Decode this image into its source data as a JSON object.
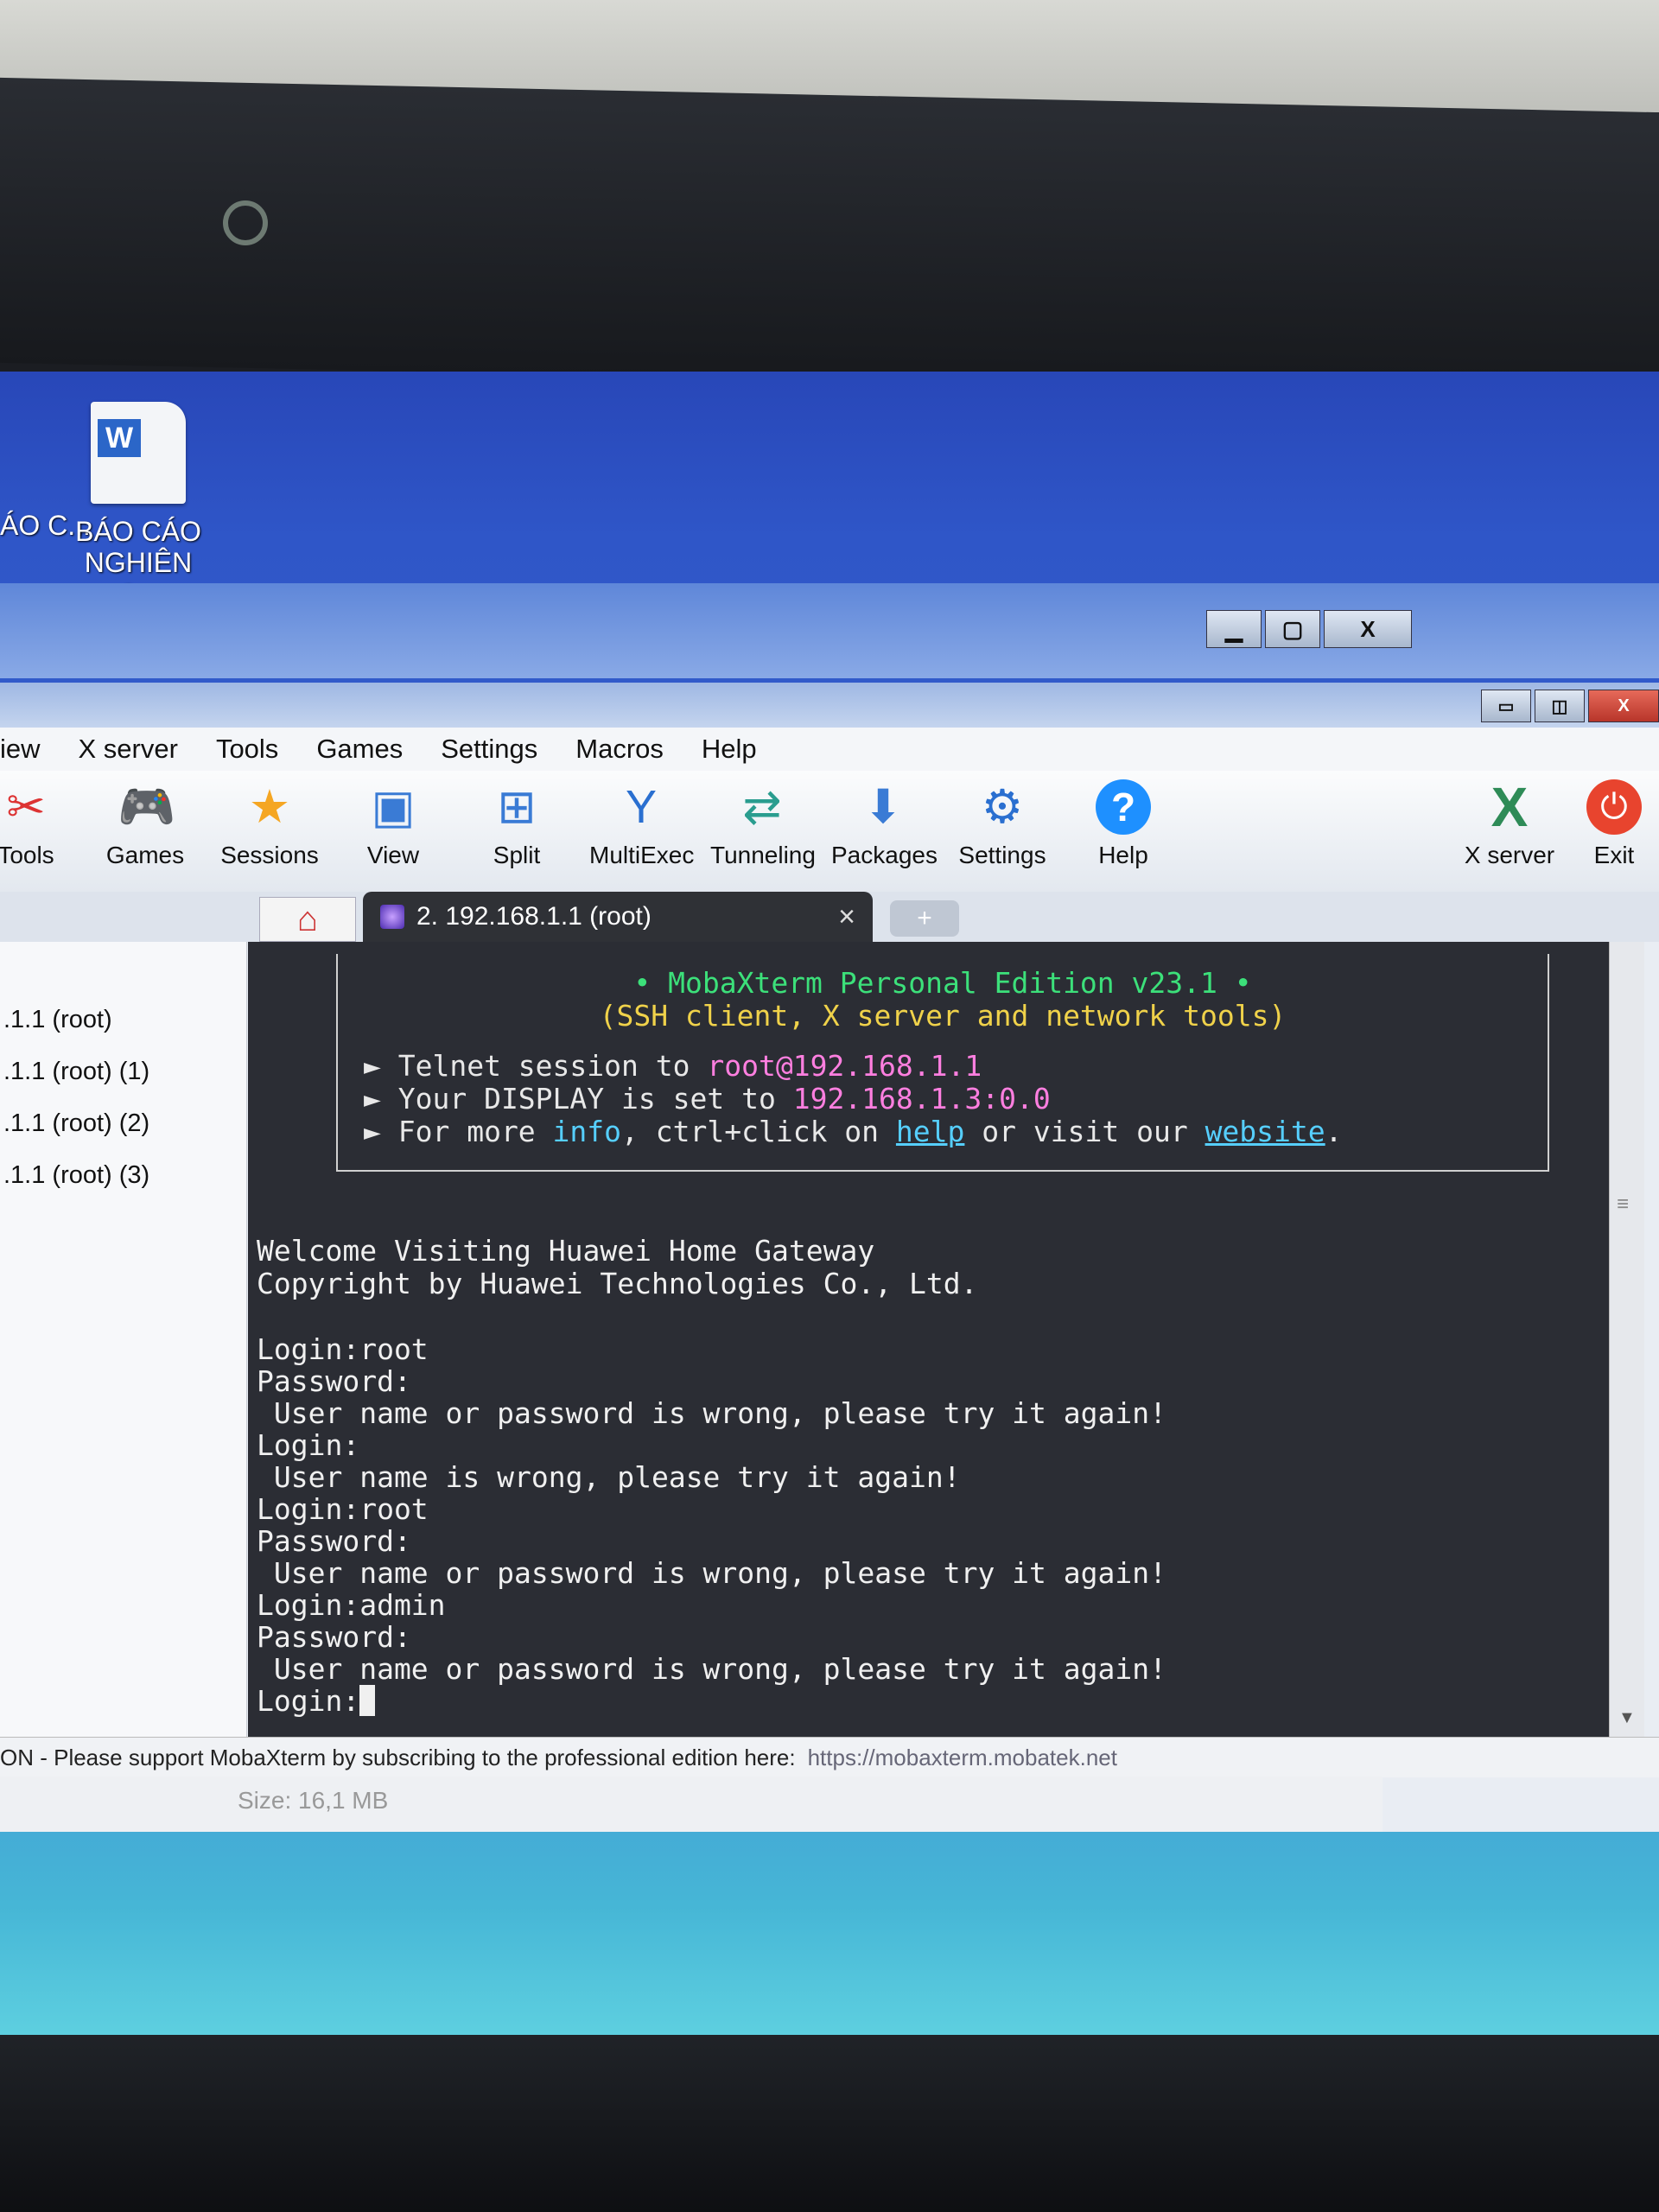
{
  "desktop": {
    "icon_label": "BÁO CÁO NGHIÊN C...",
    "left_cut_label": "ÁO C..."
  },
  "back_window": {
    "buttons": [
      "▁",
      "▢",
      "X"
    ]
  },
  "app": {
    "window_buttons": [
      "▭",
      "◫",
      "X"
    ],
    "menu": [
      "iew",
      "X server",
      "Tools",
      "Games",
      "Settings",
      "Macros",
      "Help"
    ],
    "toolbar": [
      {
        "label": "Tools",
        "icon": "tools-icon"
      },
      {
        "label": "Games",
        "icon": "gamepad-icon"
      },
      {
        "label": "Sessions",
        "icon": "star-icon"
      },
      {
        "label": "View",
        "icon": "view-icon"
      },
      {
        "label": "Split",
        "icon": "split-icon"
      },
      {
        "label": "MultiExec",
        "icon": "multiexec-icon"
      },
      {
        "label": "Tunneling",
        "icon": "tunneling-icon"
      },
      {
        "label": "Packages",
        "icon": "packages-icon"
      },
      {
        "label": "Settings",
        "icon": "gear-icon"
      },
      {
        "label": "Help",
        "icon": "help-icon"
      },
      {
        "label": "X server",
        "icon": "xserver-icon"
      },
      {
        "label": "Exit",
        "icon": "power-icon"
      }
    ],
    "tab": {
      "title": "2. 192.168.1.1 (root)",
      "close": "×",
      "new": "+",
      "home": "⌂"
    },
    "sidebar_items": [
      ".1.1 (root)",
      ".1.1 (root) (1)",
      ".1.1 (root) (2)",
      ".1.1 (root) (3)"
    ],
    "terminal": {
      "banner_title": "• MobaXterm Personal Edition v23.1 •",
      "banner_subtitle": "(SSH client, X server and network tools)",
      "b1_pre": "► Telnet session to ",
      "b1_host": "root@192.168.1.1",
      "b2_pre": "► Your DISPLAY is set to ",
      "b2_disp": "192.168.1.3:0.0",
      "b3_pre": "► For more ",
      "b3_info": "info",
      "b3_mid": ", ctrl+click on ",
      "b3_help": "help",
      "b3_mid2": " or visit our ",
      "b3_web": "website",
      "b3_end": ".",
      "lines": [
        "Welcome Visiting Huawei Home Gateway",
        "Copyright by Huawei Technologies Co., Ltd.",
        "",
        "Login:root",
        "Password:",
        " User name or password is wrong, please try it again!",
        "Login:",
        " User name is wrong, please try it again!",
        "Login:root",
        "Password:",
        " User name or password is wrong, please try it again!",
        "Login:admin",
        "Password:",
        " User name or password is wrong, please try it again!",
        "Login:"
      ]
    },
    "status": {
      "text": "ON  -  Please support MobaXterm by subscribing to the professional edition here:",
      "url": "https://mobaxterm.mobatek.net"
    },
    "below": {
      "size": "Size: 16,1 MB"
    }
  },
  "colors": {
    "terminal_bg": "#2b2d34",
    "green": "#3ce07a",
    "yellow": "#f0d24a",
    "pink": "#ff7fe0",
    "cyan": "#56cfff"
  }
}
